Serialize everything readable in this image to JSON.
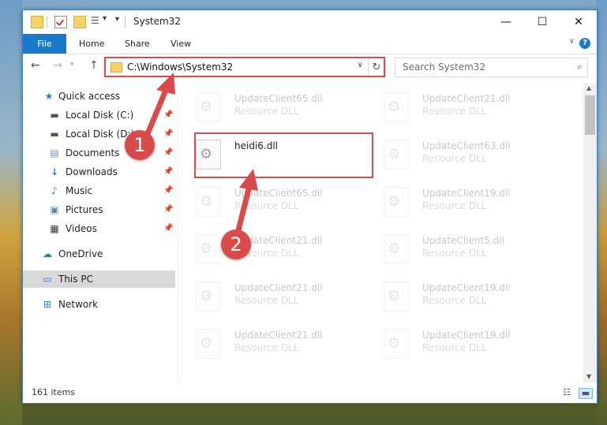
{
  "window": {
    "title": "System32"
  },
  "ribbon": {
    "tabs": [
      "File",
      "Home",
      "Share",
      "View"
    ],
    "help": "?"
  },
  "address": {
    "path": "C:\\Windows\\System32"
  },
  "search": {
    "placeholder": "Search System32"
  },
  "sidebar": {
    "items": [
      {
        "label": "Quick access",
        "icon": "star-icon",
        "pinned": false
      },
      {
        "label": "Local Disk (C:)",
        "icon": "drive-icon",
        "pinned": true
      },
      {
        "label": "Local Disk (D:)",
        "icon": "drive-icon",
        "pinned": true
      },
      {
        "label": "Documents",
        "icon": "documents-icon",
        "pinned": true
      },
      {
        "label": "Downloads",
        "icon": "download-icon",
        "pinned": true
      },
      {
        "label": "Music",
        "icon": "music-icon",
        "pinned": true
      },
      {
        "label": "Pictures",
        "icon": "pictures-icon",
        "pinned": true
      },
      {
        "label": "Videos",
        "icon": "videos-icon",
        "pinned": true
      },
      {
        "label": "OneDrive",
        "icon": "cloud-icon",
        "pinned": false
      },
      {
        "label": "This PC",
        "icon": "computer-icon",
        "pinned": false,
        "selected": true
      },
      {
        "label": "Network",
        "icon": "network-icon",
        "pinned": false
      }
    ]
  },
  "files": {
    "left": [
      {
        "name": "UpdateClient65.dll",
        "type": "Resource DLL",
        "faded": true
      },
      {
        "name": "heidi6.dll",
        "type": "",
        "faded": false,
        "highlighted": true
      },
      {
        "name": "UpdateClient65.dll",
        "type": "Resource DLL",
        "faded": true
      },
      {
        "name": "UpdateClient21.dll",
        "type": "Resource DLL",
        "faded": true
      },
      {
        "name": "UpdateClient21.dll",
        "type": "Resource DLL",
        "faded": true
      },
      {
        "name": "UpdateClient21.dll",
        "type": "Resource DLL",
        "faded": true
      }
    ],
    "right": [
      {
        "name": "UpdateClient21.dll",
        "type": "Resource DLL",
        "faded": true
      },
      {
        "name": "UpdateClient63.dll",
        "type": "Resource DLL",
        "faded": true
      },
      {
        "name": "UpdateClient19.dll",
        "type": "Resource DLL",
        "faded": true
      },
      {
        "name": "UpdateClient5.dll",
        "type": "Resource DLL",
        "faded": true
      },
      {
        "name": "UpdateClient19.dll",
        "type": "Resource DLL",
        "faded": true
      },
      {
        "name": "UpdateClient19.dll",
        "type": "Resource DLL",
        "faded": true
      }
    ]
  },
  "status": {
    "count": "161 items"
  },
  "annotations": {
    "step1": "1",
    "step2": "2",
    "color": "#d94b4b"
  }
}
